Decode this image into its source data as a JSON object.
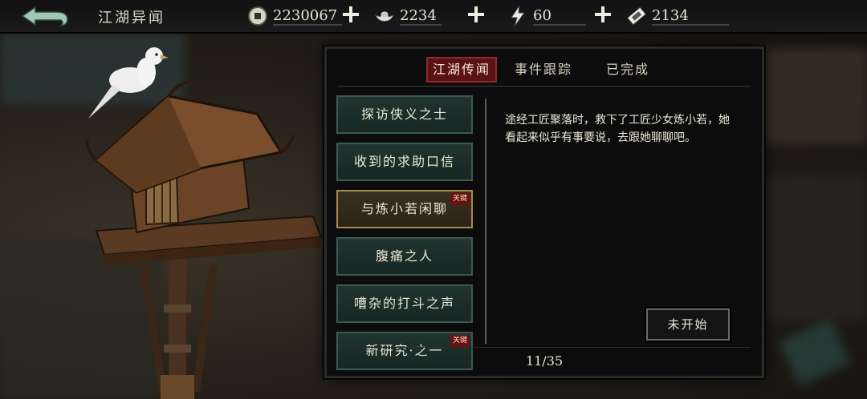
{
  "header": {
    "title": "江湖异闻",
    "back_icon": "back-arrow-icon",
    "resources": [
      {
        "icon": "coin-icon",
        "value": "2230067",
        "addable": true
      },
      {
        "icon": "silver-ingot-icon",
        "value": "2234",
        "addable": true
      },
      {
        "icon": "lightning-icon",
        "value": "60",
        "addable": true
      },
      {
        "icon": "ticket-icon",
        "value": "2134",
        "addable": false
      }
    ]
  },
  "tabs": [
    {
      "label": "江湖传闻",
      "active": true
    },
    {
      "label": "事件跟踪",
      "active": false
    },
    {
      "label": "已完成",
      "active": false
    }
  ],
  "quests": [
    {
      "name": "探访侠义之士",
      "key": false,
      "selected": false
    },
    {
      "name": "收到的求助口信",
      "key": false,
      "selected": false
    },
    {
      "name": "与炼小若闲聊",
      "key": true,
      "selected": true
    },
    {
      "name": "腹痛之人",
      "key": false,
      "selected": false
    },
    {
      "name": "嘈杂的打斗之声",
      "key": false,
      "selected": false
    },
    {
      "name": "新研究·之一",
      "key": true,
      "selected": false
    }
  ],
  "key_tag_label": "关键",
  "detail": {
    "description": "途经工匠聚落时，救下了工匠少女炼小若，她看起来似乎有事要说，去跟她聊聊吧。",
    "status_button": "未开始"
  },
  "pagination": "11/35",
  "colors": {
    "active_tab": "#5b1212",
    "quest_bg": "#203430",
    "selected_quest_border": "#a88a4a",
    "key_tag": "#6a1010"
  }
}
